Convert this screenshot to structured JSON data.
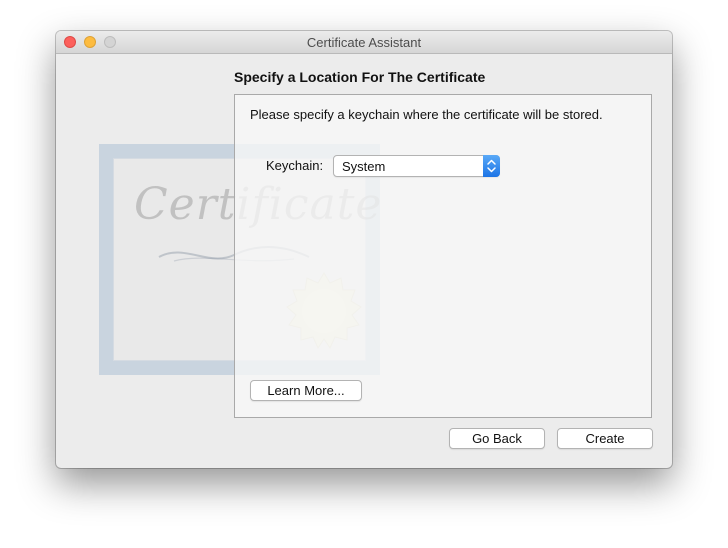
{
  "window": {
    "title": "Certificate Assistant"
  },
  "main": {
    "heading": "Specify a Location For The Certificate",
    "instruction": "Please specify a keychain where the certificate will be stored.",
    "keychain_label": "Keychain:",
    "keychain_value": "System",
    "learn_more_label": "Learn More..."
  },
  "footer": {
    "go_back_label": "Go Back",
    "create_label": "Create"
  },
  "graphic": {
    "certificate_text": "Certificate"
  },
  "colors": {
    "close": "#fc605c",
    "minimize": "#fdbc40",
    "zoom": "#d4d4d4",
    "popup_accent": "#1c74e6"
  }
}
